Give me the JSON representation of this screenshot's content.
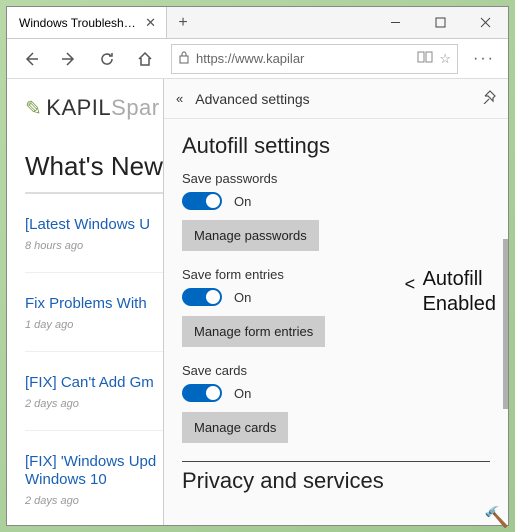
{
  "browser": {
    "tab_title": "Windows Troubleshooti",
    "url_display": "https://www.kapilar",
    "window_buttons": {
      "minimize": "—",
      "maximize": "▢",
      "close": "✕"
    }
  },
  "page": {
    "logo_first": "KAPIL",
    "logo_rest": "Spar",
    "section_heading": "What's New",
    "posts": [
      {
        "title": "[Latest Windows U",
        "ago": "8 hours ago"
      },
      {
        "title": "Fix Problems With",
        "ago": "1 day ago"
      },
      {
        "title": "[FIX] Can't Add Gm",
        "ago": "2 days ago"
      },
      {
        "title": "[FIX] 'Windows Upd",
        "title2": "Windows 10",
        "ago": "2 days ago"
      }
    ]
  },
  "panel": {
    "title": "Advanced settings",
    "autofill_heading": "Autofill settings",
    "save_passwords_label": "Save passwords",
    "save_passwords_state": "On",
    "manage_passwords": "Manage passwords",
    "save_form_label": "Save form entries",
    "save_form_state": "On",
    "manage_form": "Manage form entries",
    "save_cards_label": "Save cards",
    "save_cards_state": "On",
    "manage_cards": "Manage cards",
    "privacy_heading": "Privacy and services"
  },
  "annotation": {
    "line1": "Autofill",
    "line2": "Enabled"
  },
  "icons": {
    "hammer": "🔨"
  }
}
